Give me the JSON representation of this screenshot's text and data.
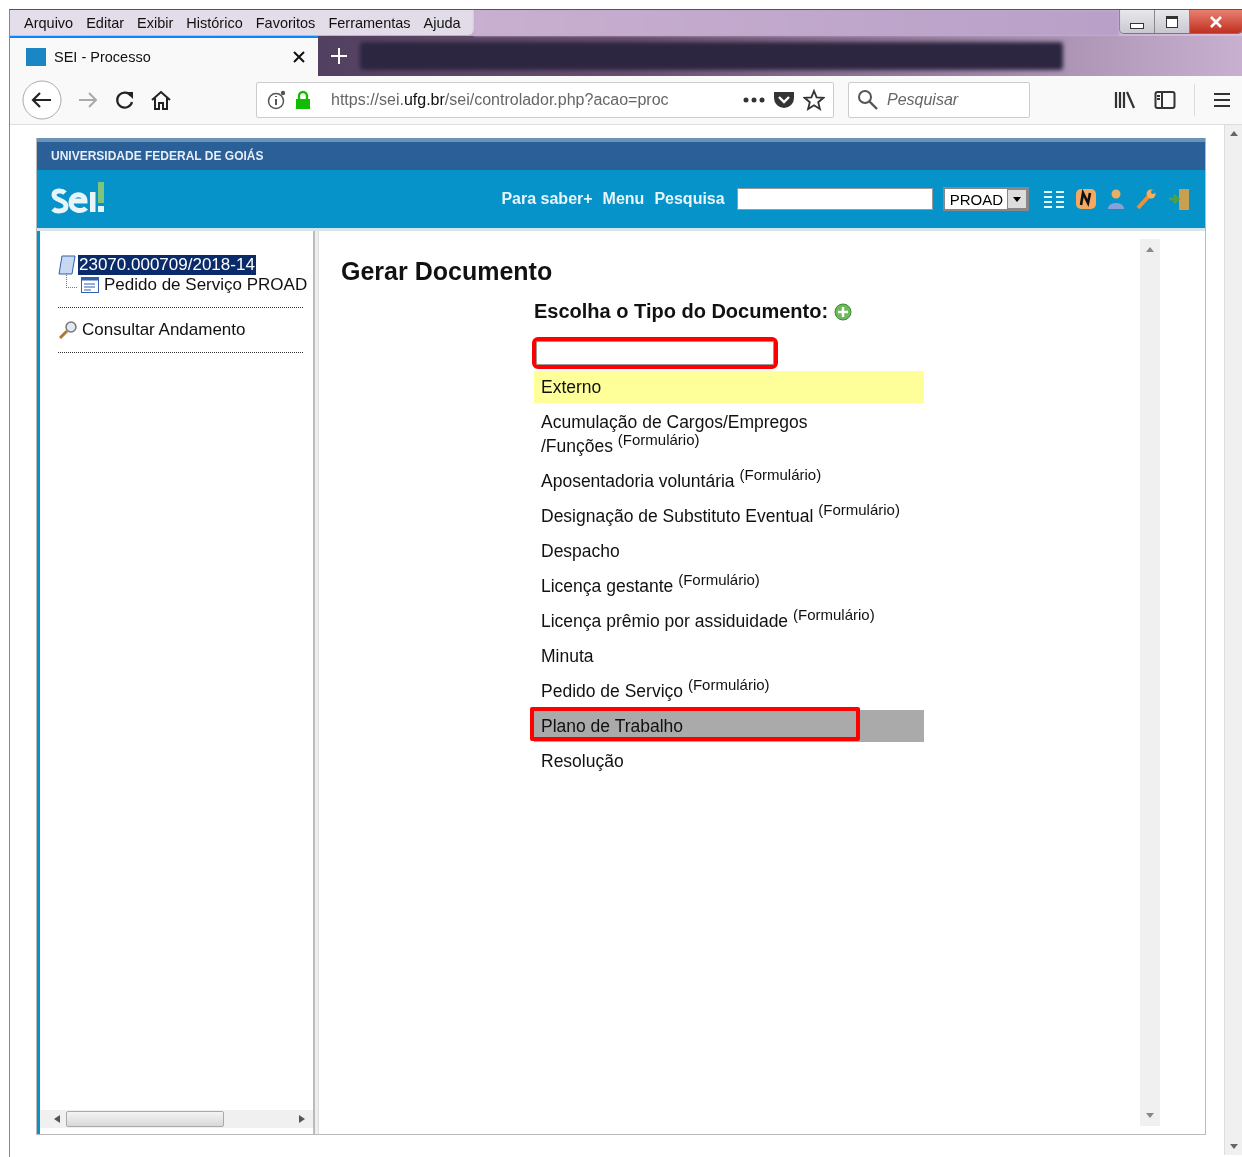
{
  "menu_bar": [
    "Arquivo",
    "Editar",
    "Exibir",
    "Histórico",
    "Favoritos",
    "Ferramentas",
    "Ajuda"
  ],
  "tab": {
    "title": "SEI - Processo"
  },
  "address_bar": {
    "host_prefix": "https://sei.",
    "host": "ufg.br",
    "path": "/sei/controlador.php?acao=proc"
  },
  "browser_search": {
    "placeholder": "Pesquisar"
  },
  "page": {
    "institution": "UNIVERSIDADE FEDERAL DE GOIÁS",
    "nav_links": [
      "Para saber+",
      "Menu",
      "Pesquisa"
    ],
    "unit_select": {
      "value": "PROAD"
    },
    "tree": {
      "label": "23070.000709/2018-14",
      "selected": true,
      "children": [
        {
          "label": "Pedido de Serviço PROAD",
          "selected": false
        }
      ]
    },
    "side_links": [
      "Consultar Andamento"
    ],
    "title": "Gerar Documento",
    "subtitle": "Escolha o Tipo do Documento:",
    "filter_field": {
      "marked": true
    },
    "document_types": [
      {
        "label": "Externo",
        "highlighted": true,
        "selected": false,
        "marked": false
      },
      {
        "label": "Acumulação de Cargos/Empregos\n/Funções $^{(Formulário)}$",
        "highlighted": false,
        "selected": false,
        "marked": false
      },
      {
        "label": "Aposentadoria voluntária $^{(Formulário)}$",
        "highlighted": false,
        "selected": false,
        "marked": false
      },
      {
        "label": "Designação de Substituto Eventual $^{(Formulário)}$",
        "highlighted": false,
        "selected": false,
        "marked": false
      },
      {
        "label": "Despacho",
        "highlighted": false,
        "selected": false,
        "marked": false
      },
      {
        "label": "Licença gestante $^{(Formulário)}$",
        "highlighted": false,
        "selected": false,
        "marked": false
      },
      {
        "label": "Licença prêmio por assiduidade $^{(Formulário)}$",
        "highlighted": false,
        "selected": false,
        "marked": false
      },
      {
        "label": "Minuta",
        "highlighted": false,
        "selected": false,
        "marked": false
      },
      {
        "label": "Pedido de Serviço $^{(Formulário)}$",
        "highlighted": false,
        "selected": false,
        "marked": false
      },
      {
        "label": "Plano de Trabalho",
        "highlighted": false,
        "selected": true,
        "marked": true
      },
      {
        "label": "Resolução",
        "highlighted": false,
        "selected": false,
        "marked": false
      }
    ]
  }
}
